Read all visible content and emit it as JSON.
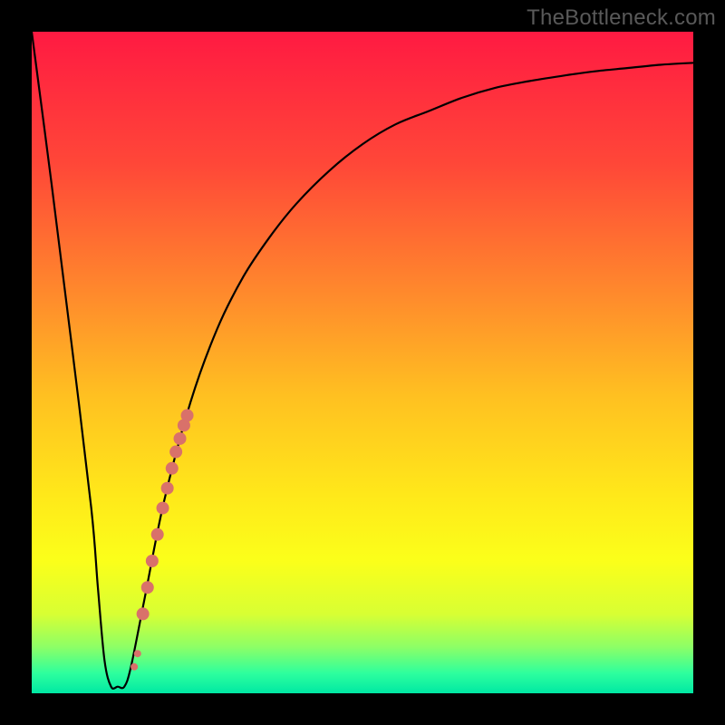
{
  "watermark": "TheBottleneck.com",
  "colors": {
    "frame": "#000000",
    "curve": "#000000",
    "marker": "#d9716a",
    "gradient_stops": [
      {
        "offset": 0.0,
        "color": "#ff1a42"
      },
      {
        "offset": 0.2,
        "color": "#ff4738"
      },
      {
        "offset": 0.4,
        "color": "#ff8b2c"
      },
      {
        "offset": 0.55,
        "color": "#ffc021"
      },
      {
        "offset": 0.7,
        "color": "#ffe81a"
      },
      {
        "offset": 0.8,
        "color": "#fbff1a"
      },
      {
        "offset": 0.88,
        "color": "#d8ff33"
      },
      {
        "offset": 0.93,
        "color": "#8dff66"
      },
      {
        "offset": 0.97,
        "color": "#2dff9e"
      },
      {
        "offset": 1.0,
        "color": "#00e8a3"
      }
    ]
  },
  "chart_data": {
    "type": "line",
    "title": "",
    "xlabel": "",
    "ylabel": "",
    "xlim": [
      0,
      100
    ],
    "ylim": [
      0,
      100
    ],
    "series": [
      {
        "name": "bottleneck-curve",
        "x": [
          0,
          3,
          6,
          9,
          10,
          11,
          12,
          13,
          14,
          15,
          17,
          20,
          24,
          28,
          32,
          36,
          40,
          45,
          50,
          55,
          60,
          65,
          70,
          75,
          80,
          85,
          90,
          95,
          100
        ],
        "values": [
          100,
          77,
          53,
          28,
          16,
          5,
          1,
          1,
          1,
          4,
          14,
          29,
          44,
          55,
          63,
          69,
          74,
          79,
          83,
          86,
          88,
          90,
          91.5,
          92.5,
          93.3,
          94,
          94.5,
          95,
          95.3
        ]
      }
    ],
    "markers": {
      "name": "highlight-points",
      "x": [
        15.5,
        16.0,
        16.8,
        17.5,
        18.2,
        19.0,
        19.8,
        20.5,
        21.2,
        21.8,
        22.4,
        23.0,
        23.5
      ],
      "values": [
        4.0,
        6.0,
        12.0,
        16.0,
        20.0,
        24.0,
        28.0,
        31.0,
        34.0,
        36.5,
        38.5,
        40.5,
        42.0
      ],
      "r": [
        4,
        4,
        7,
        7,
        7,
        7,
        7,
        7,
        7,
        7,
        7,
        7,
        7
      ]
    }
  }
}
